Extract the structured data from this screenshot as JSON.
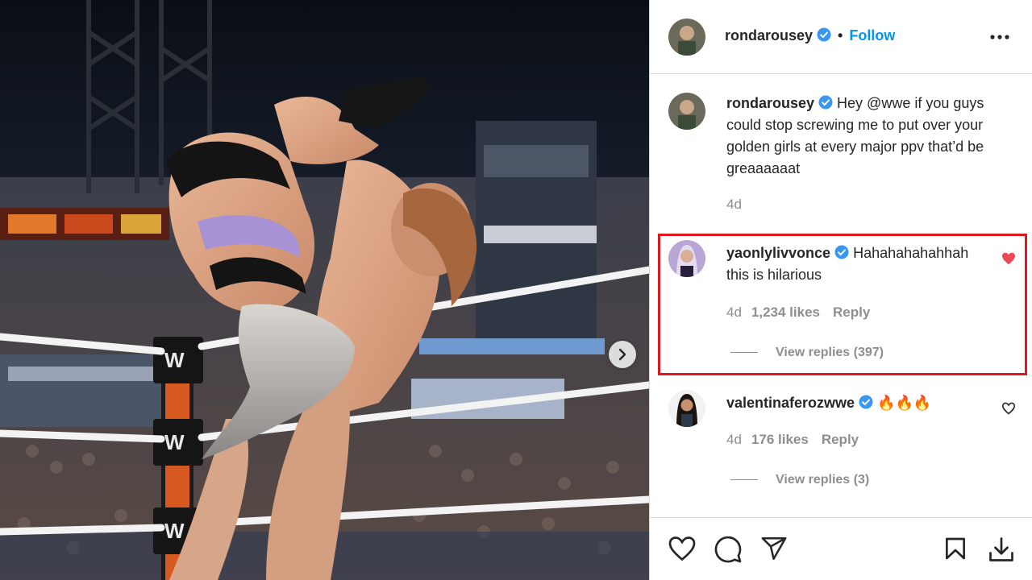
{
  "post": {
    "author": "rondarousey",
    "separator": "•",
    "follow_label": "Follow",
    "more_icon": "more-options-icon"
  },
  "caption": {
    "username": "rondarousey",
    "text": "Hey @wwe if you guys could stop screwing me to put over your golden girls at every major ppv that’d be greaaaaaat",
    "time": "4d"
  },
  "comments": [
    {
      "username": "yaonlylivvonce",
      "text": "Hahahahahahhah this is hilarious",
      "time": "4d",
      "likes": "1,234 likes",
      "reply_label": "Reply",
      "view_replies": "View replies (397)",
      "liked": true
    },
    {
      "username": "valentinaferozwwe",
      "text": "🔥🔥🔥",
      "time": "4d",
      "likes": "176 likes",
      "reply_label": "Reply",
      "view_replies": "View replies (3)",
      "liked": false
    }
  ],
  "colors": {
    "link_blue": "#0095f6",
    "verified_blue": "#3897f0",
    "like_red": "#ed4956",
    "highlight_red": "#e0161e"
  },
  "icons": [
    "heart-icon",
    "comment-icon",
    "share-icon",
    "bookmark-icon",
    "download-icon",
    "chevron-right-icon"
  ]
}
